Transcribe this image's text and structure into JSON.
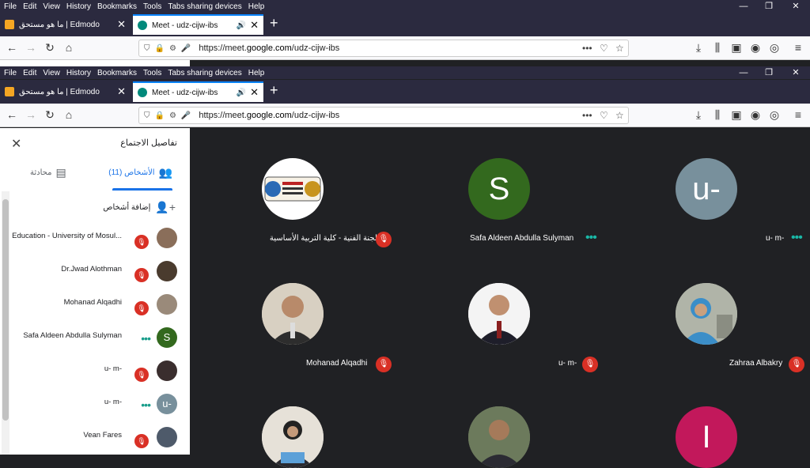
{
  "menu": [
    "File",
    "Edit",
    "View",
    "History",
    "Bookmarks",
    "Tools",
    "Tabs sharing devices",
    "Help"
  ],
  "window_controls": {
    "minimize": "—",
    "restore": "❐",
    "close": "✕"
  },
  "tabs": [
    {
      "title": "ما هو مستحق | Edmodo",
      "close": "✕"
    },
    {
      "title": "Meet - udz-cijw-ibs",
      "close": "✕",
      "audio": "🔊"
    }
  ],
  "new_tab": "+",
  "url": {
    "prefix": "https://meet.",
    "domain": "google.com",
    "path": "/udz-cijw-ibs"
  },
  "panel": {
    "title": "تفاصيل الاجتماع",
    "tab_people": "الأشخاص (11)",
    "tab_chat": "محادثة",
    "add_people": "إضافة أشخاص",
    "participants": [
      {
        "name": "Education - University of Mosul...",
        "status": "muted",
        "avatar": "photo"
      },
      {
        "name": "Dr.Jwad Alothman",
        "status": "muted",
        "avatar": "photo"
      },
      {
        "name": "Mohanad Alqadhi",
        "status": "muted",
        "avatar": "photo"
      },
      {
        "name": "Safa Aldeen Abdulla Sulyman",
        "status": "speaking",
        "avatar": "S"
      },
      {
        "name": "u- m-",
        "status": "muted",
        "avatar": "photo"
      },
      {
        "name": "u- m-",
        "status": "speaking",
        "avatar": "u-"
      },
      {
        "name": "Vean Fares",
        "status": "muted",
        "avatar": "photo"
      }
    ]
  },
  "grid": [
    {
      "name": "اللجنة الفنية - كلية التربية الأساسية",
      "status": "muted",
      "avatar": "logo"
    },
    {
      "name": "Safa Aldeen Abdulla Sulyman",
      "status": "speaking",
      "avatar": "S"
    },
    {
      "name": "u- m-",
      "status": "speaking",
      "avatar": "u-"
    },
    {
      "name": "Mohanad Alqadhi",
      "status": "muted",
      "avatar": "photo"
    },
    {
      "name": "u- m-",
      "status": "muted",
      "avatar": "photo"
    },
    {
      "name": "Zahraa Albakry",
      "status": "muted",
      "avatar": "photo"
    },
    {
      "name": "",
      "status": "",
      "avatar": "photo"
    },
    {
      "name": "",
      "status": "",
      "avatar": "photo"
    },
    {
      "name": "",
      "status": "",
      "avatar": "I"
    }
  ],
  "colors": {
    "accent": "#1a73e8",
    "mute": "#d93025",
    "speaking": "#1ab7a6",
    "bg": "#202124",
    "chrome": "#2b2a3f"
  }
}
